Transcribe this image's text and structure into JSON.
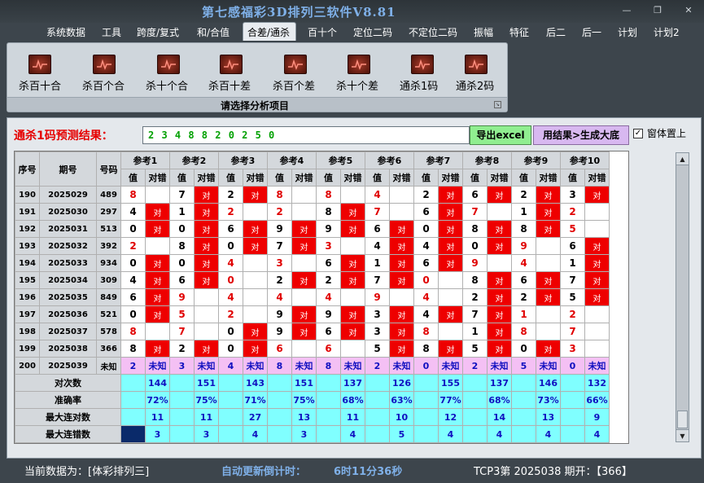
{
  "app": {
    "title": "第七感福彩3D排列三软件V8.81",
    "window_controls": [
      "—",
      "❐",
      "✕"
    ]
  },
  "menu": [
    "系统数据",
    "工具",
    "跨度/复式",
    "和/合值",
    "合差/通杀",
    "百十个",
    "定位二码",
    "不定位二码",
    "振幅",
    "特征",
    "后二",
    "后一",
    "计划",
    "计划2"
  ],
  "ribbon": {
    "items": [
      "杀百十合",
      "杀百个合",
      "杀十个合",
      "杀百十差",
      "杀百个差",
      "杀十个差",
      "通杀1码",
      "通杀2码"
    ],
    "caption": "请选择分析项目",
    "icon": "chart-icon"
  },
  "prediction": {
    "label": "通杀1码预测结果：",
    "value": "2 3 4 8 8 2 0 2 5 0",
    "excel_button": "导出excel",
    "generate_button": "用结果>生成大底",
    "ontop_label": "窗体置上",
    "ontop_checked": "✓"
  },
  "table": {
    "headers": {
      "seq": "序号",
      "period": "期号",
      "number": "号码",
      "refs": [
        "参考1",
        "参考2",
        "参考3",
        "参考4",
        "参考5",
        "参考6",
        "参考7",
        "参考8",
        "参考9",
        "参考10"
      ],
      "val": "值",
      "hit": "对错"
    },
    "hit_text": "对",
    "rows": [
      {
        "seq": "190",
        "period": "2025029",
        "number": "489",
        "values": [
          "8",
          "7",
          "2",
          "8",
          "8",
          "4",
          "2",
          "6",
          "2",
          "3"
        ],
        "hits": [
          0,
          1,
          1,
          0,
          0,
          0,
          1,
          1,
          1,
          1
        ],
        "red_values": [
          1,
          0,
          0,
          1,
          1,
          1,
          0,
          0,
          0,
          0
        ]
      },
      {
        "seq": "191",
        "period": "2025030",
        "number": "297",
        "values": [
          "4",
          "1",
          "2",
          "2",
          "8",
          "7",
          "6",
          "7",
          "1",
          "2"
        ],
        "hits": [
          1,
          1,
          0,
          0,
          1,
          0,
          1,
          0,
          1,
          0
        ],
        "red_values": [
          0,
          0,
          1,
          1,
          0,
          1,
          0,
          1,
          0,
          1
        ]
      },
      {
        "seq": "192",
        "period": "2025031",
        "number": "513",
        "values": [
          "0",
          "0",
          "6",
          "9",
          "9",
          "6",
          "0",
          "8",
          "8",
          "5"
        ],
        "hits": [
          1,
          1,
          1,
          1,
          1,
          1,
          1,
          1,
          1,
          0
        ],
        "red_values": [
          0,
          0,
          0,
          0,
          0,
          0,
          0,
          0,
          0,
          1
        ]
      },
      {
        "seq": "193",
        "period": "2025032",
        "number": "392",
        "values": [
          "2",
          "8",
          "0",
          "7",
          "3",
          "4",
          "4",
          "0",
          "9",
          "6"
        ],
        "hits": [
          0,
          1,
          1,
          1,
          0,
          1,
          1,
          1,
          0,
          1
        ],
        "red_values": [
          1,
          0,
          0,
          0,
          1,
          0,
          0,
          0,
          1,
          0
        ]
      },
      {
        "seq": "194",
        "period": "2025033",
        "number": "934",
        "values": [
          "0",
          "0",
          "4",
          "3",
          "6",
          "1",
          "6",
          "9",
          "4",
          "1"
        ],
        "hits": [
          1,
          1,
          0,
          0,
          1,
          1,
          1,
          0,
          0,
          1
        ],
        "red_values": [
          0,
          0,
          1,
          1,
          0,
          0,
          0,
          1,
          1,
          0
        ]
      },
      {
        "seq": "195",
        "period": "2025034",
        "number": "309",
        "values": [
          "4",
          "6",
          "0",
          "2",
          "2",
          "7",
          "0",
          "8",
          "6",
          "7"
        ],
        "hits": [
          1,
          1,
          0,
          1,
          1,
          1,
          0,
          1,
          1,
          1
        ],
        "red_values": [
          0,
          0,
          1,
          0,
          0,
          0,
          1,
          0,
          0,
          0
        ]
      },
      {
        "seq": "196",
        "period": "2025035",
        "number": "849",
        "values": [
          "6",
          "9",
          "4",
          "4",
          "4",
          "9",
          "4",
          "2",
          "2",
          "5"
        ],
        "hits": [
          1,
          0,
          0,
          0,
          0,
          0,
          0,
          1,
          1,
          1
        ],
        "red_values": [
          0,
          1,
          1,
          1,
          1,
          1,
          1,
          0,
          0,
          0
        ]
      },
      {
        "seq": "197",
        "period": "2025036",
        "number": "521",
        "values": [
          "0",
          "5",
          "2",
          "9",
          "9",
          "3",
          "4",
          "7",
          "1",
          "2"
        ],
        "hits": [
          1,
          0,
          0,
          1,
          1,
          1,
          1,
          1,
          0,
          0
        ],
        "red_values": [
          0,
          1,
          1,
          0,
          0,
          0,
          0,
          0,
          1,
          1
        ]
      },
      {
        "seq": "198",
        "period": "2025037",
        "number": "578",
        "values": [
          "8",
          "7",
          "0",
          "9",
          "6",
          "3",
          "8",
          "1",
          "8",
          "7"
        ],
        "hits": [
          0,
          0,
          1,
          1,
          1,
          1,
          0,
          1,
          0,
          0
        ],
        "red_values": [
          1,
          1,
          0,
          0,
          0,
          0,
          1,
          0,
          1,
          1
        ]
      },
      {
        "seq": "199",
        "period": "2025038",
        "number": "366",
        "values": [
          "8",
          "2",
          "0",
          "6",
          "6",
          "5",
          "8",
          "5",
          "0",
          "3"
        ],
        "hits": [
          1,
          1,
          1,
          0,
          0,
          1,
          1,
          1,
          1,
          0
        ],
        "red_values": [
          0,
          0,
          0,
          1,
          1,
          0,
          0,
          0,
          0,
          1
        ]
      },
      {
        "seq": "200",
        "period": "2025039",
        "number": "未知",
        "values": [
          "2",
          "3",
          "4",
          "8",
          "8",
          "2",
          "0",
          "2",
          "5",
          "0"
        ],
        "unknown": "未知"
      }
    ],
    "stats": [
      {
        "label": "对次数",
        "values": [
          "144",
          "151",
          "143",
          "151",
          "137",
          "126",
          "155",
          "137",
          "146",
          "132"
        ]
      },
      {
        "label": "准确率",
        "values": [
          "72%",
          "75%",
          "71%",
          "75%",
          "68%",
          "63%",
          "77%",
          "68%",
          "73%",
          "66%"
        ]
      },
      {
        "label": "最大连对数",
        "values": [
          "11",
          "11",
          "27",
          "13",
          "11",
          "10",
          "12",
          "14",
          "13",
          "9"
        ]
      },
      {
        "label": "最大连错数",
        "values": [
          "3",
          "3",
          "4",
          "3",
          "4",
          "5",
          "4",
          "4",
          "4",
          "4"
        ]
      }
    ]
  },
  "status": {
    "current_data": "当前数据为：[体彩排列三]",
    "countdown_label": "自动更新倒计时：",
    "countdown_value": "6时11分36秒",
    "draw_info": "TCP3第 2025038 期开：【366】"
  },
  "colors": {
    "hit": "#ee0000",
    "unknown": "#f4c0f4",
    "stats": "#80ffff",
    "excel": "#90ee90",
    "generate": "#d8b8f0",
    "title": "#7fb0e8"
  }
}
